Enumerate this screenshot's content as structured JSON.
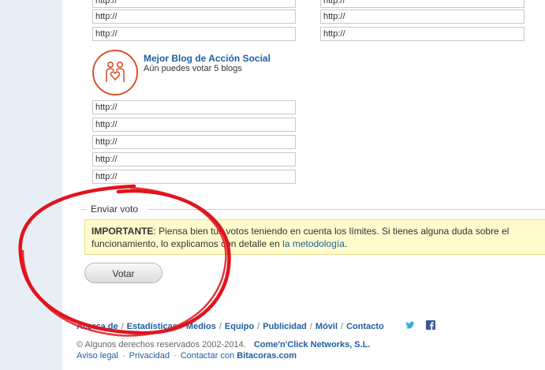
{
  "top_fields": {
    "placeholder": "http://",
    "left_values": [
      "http://",
      "http://",
      "http://"
    ],
    "right_values": [
      "http://",
      "http://",
      "http://"
    ]
  },
  "category": {
    "icon": "couple-heart-icon",
    "title": "Mejor Blog de Acción Social",
    "subtitle": "Aún puedes votar 5 blogs",
    "fields": [
      "http://",
      "http://",
      "http://",
      "http://",
      "http://"
    ]
  },
  "send_vote": {
    "legend": "Enviar voto",
    "notice_strong": "IMPORTANTE",
    "notice_text": ": Piensa bien tus votos teniendo en cuenta los límites. Si tienes alguna duda sobre el funcionamiento, lo explicamos con detalle en ",
    "notice_link": "la metodología",
    "notice_end": ".",
    "button_label": "Votar"
  },
  "footer": {
    "nav": [
      "Acerca de",
      "Estadísticas",
      "Medios",
      "Equipo",
      "Publicidad",
      "Móvil",
      "Contacto"
    ],
    "nav_separator": "/",
    "social_icons": [
      "twitter-icon",
      "facebook-icon"
    ],
    "copyright": "© Algunos derechos reservados 2002-2014.",
    "company": "Come'n'Click Networks, S.L.",
    "links": [
      "Aviso legal",
      "Privacidad",
      "Contactar con"
    ],
    "links_separator": "·",
    "brand": "Bitacoras.com"
  },
  "colors": {
    "brand_orange": "#d9532b",
    "link_blue": "#1f5fa0",
    "notice_bg": "#fffbcc",
    "annotation_red": "#e0141e"
  }
}
